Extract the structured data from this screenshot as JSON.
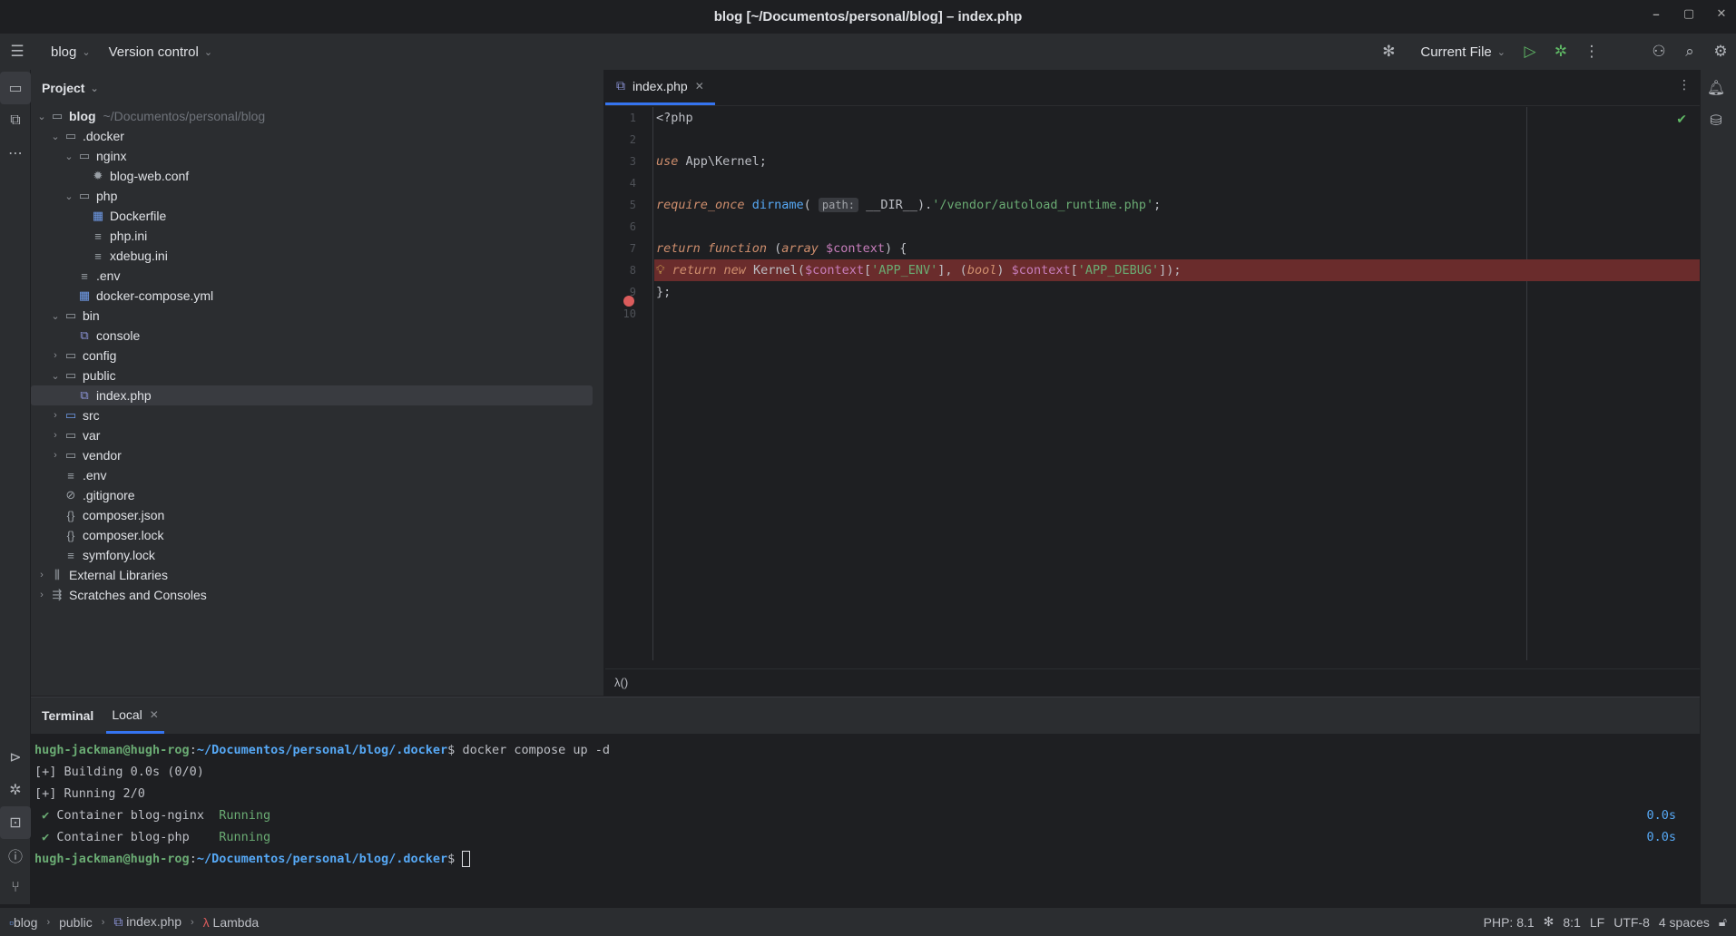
{
  "window": {
    "title": "blog [~/Documentos/personal/blog] – index.php",
    "controls": [
      "–",
      "▢",
      "✕"
    ]
  },
  "toolbar": {
    "project_name": "blog",
    "vcs_label": "Version control",
    "run_config": "Current File"
  },
  "project_panel": {
    "title": "Project",
    "root": {
      "name": "blog",
      "path": "~/Documentos/personal/blog"
    },
    "items": [
      {
        "label": ".docker",
        "depth": 1,
        "kind": "folder",
        "arrow": "open"
      },
      {
        "label": "nginx",
        "depth": 2,
        "kind": "folder",
        "arrow": "open"
      },
      {
        "label": "blog-web.conf",
        "depth": 3,
        "kind": "conf",
        "arrow": "none"
      },
      {
        "label": "php",
        "depth": 2,
        "kind": "folder",
        "arrow": "open"
      },
      {
        "label": "Dockerfile",
        "depth": 3,
        "kind": "docker",
        "arrow": "none"
      },
      {
        "label": "php.ini",
        "depth": 3,
        "kind": "text",
        "arrow": "none"
      },
      {
        "label": "xdebug.ini",
        "depth": 3,
        "kind": "text",
        "arrow": "none"
      },
      {
        "label": ".env",
        "depth": 2,
        "kind": "text",
        "arrow": "none"
      },
      {
        "label": "docker-compose.yml",
        "depth": 2,
        "kind": "docker",
        "arrow": "none"
      },
      {
        "label": "bin",
        "depth": 1,
        "kind": "folder",
        "arrow": "open"
      },
      {
        "label": "console",
        "depth": 2,
        "kind": "php",
        "arrow": "none"
      },
      {
        "label": "config",
        "depth": 1,
        "kind": "folder",
        "arrow": "closed"
      },
      {
        "label": "public",
        "depth": 1,
        "kind": "folder",
        "arrow": "open"
      },
      {
        "label": "index.php",
        "depth": 2,
        "kind": "php",
        "arrow": "none",
        "selected": true
      },
      {
        "label": "src",
        "depth": 1,
        "kind": "folder-blue",
        "arrow": "closed"
      },
      {
        "label": "var",
        "depth": 1,
        "kind": "folder",
        "arrow": "closed"
      },
      {
        "label": "vendor",
        "depth": 1,
        "kind": "folder",
        "arrow": "closed"
      },
      {
        "label": ".env",
        "depth": 1,
        "kind": "text",
        "arrow": "none"
      },
      {
        "label": ".gitignore",
        "depth": 1,
        "kind": "ignore",
        "arrow": "none"
      },
      {
        "label": "composer.json",
        "depth": 1,
        "kind": "json",
        "arrow": "none"
      },
      {
        "label": "composer.lock",
        "depth": 1,
        "kind": "json",
        "arrow": "none"
      },
      {
        "label": "symfony.lock",
        "depth": 1,
        "kind": "text",
        "arrow": "none"
      },
      {
        "label": "External Libraries",
        "depth": 0,
        "kind": "library",
        "arrow": "closed"
      },
      {
        "label": "Scratches and Consoles",
        "depth": 0,
        "kind": "scratch",
        "arrow": "closed"
      }
    ]
  },
  "editor": {
    "tab_label": "index.php",
    "line_numbers": [
      "1",
      "2",
      "3",
      "4",
      "5",
      "6",
      "7",
      "8",
      "9",
      "10"
    ],
    "code": {
      "l1": "<?php",
      "l3_kw": "use",
      "l3_rest": " App\\Kernel;",
      "l5_kw": "require_once",
      "l5_fn": "dirname",
      "l5_hint": "path:",
      "l5_const": "__DIR__",
      "l5_str": "'/vendor/autoload_runtime.php'",
      "l7_kw1": "return",
      "l7_kw2": "function",
      "l7_type": "array",
      "l7_var": "$context",
      "l8_kw1": "return",
      "l8_kw2": "new",
      "l8_cls": "Kernel",
      "l8_var1": "$context",
      "l8_str1": "'APP_ENV'",
      "l8_type": "bool",
      "l8_var2": "$context",
      "l8_str2": "'APP_DEBUG'",
      "l9": "};"
    },
    "breadcrumb": "λ()"
  },
  "terminal": {
    "title": "Terminal",
    "tab_label": "Local",
    "prompt_user": "hugh-jackman@hugh-rog",
    "prompt_path": "~/Documentos/personal/blog/.docker",
    "command": "docker compose up -d",
    "building": "[+] Building 0.0s (0/0)",
    "running": "[+] Running 2/0",
    "containers": [
      {
        "name": "Container blog-nginx ",
        "status": "Running",
        "time": "0.0s"
      },
      {
        "name": "Container blog-php   ",
        "status": "Running",
        "time": "0.0s"
      }
    ]
  },
  "statusbar": {
    "crumbs": [
      "blog",
      "public",
      "index.php",
      "Lambda"
    ],
    "php": "PHP: 8.1",
    "position": "8:1",
    "line_ending": "LF",
    "encoding": "UTF-8",
    "indent": "4 spaces"
  },
  "colors": {
    "accent": "#3574f0",
    "breakpoint": "#db5c5c",
    "breakpoint_line": "#6a2c2c"
  }
}
